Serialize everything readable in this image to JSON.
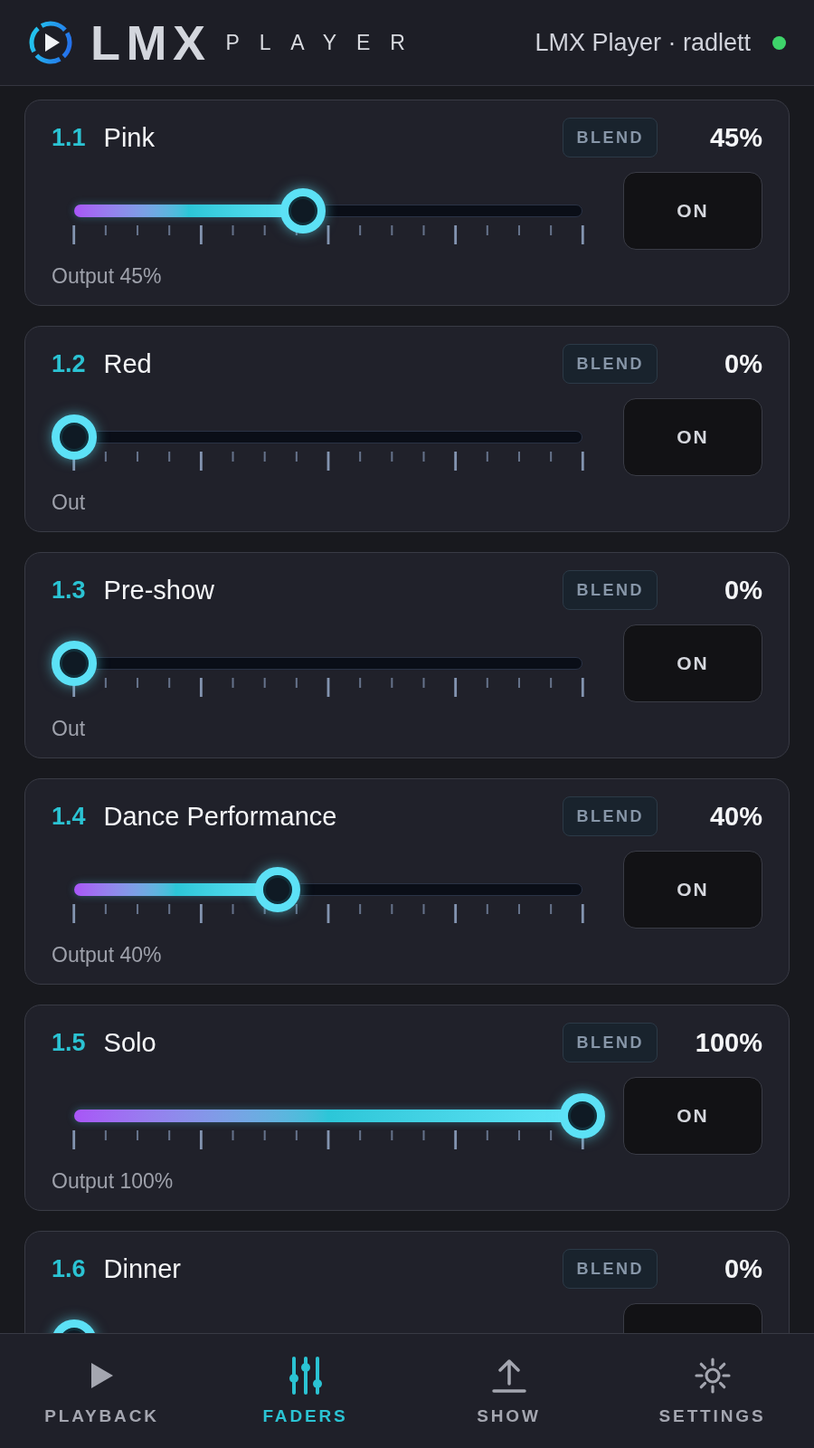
{
  "header": {
    "logo": {
      "wordmark": "LMX",
      "subtitle": "PLAYER"
    },
    "status": {
      "text": "LMX Player · radlett",
      "connected": true
    }
  },
  "faders": [
    {
      "number": "1.1",
      "name": "Pink",
      "mode": "BLEND",
      "percent": "45%",
      "level": 0.45,
      "button": "ON",
      "caption": "Output 45%"
    },
    {
      "number": "1.2",
      "name": "Red",
      "mode": "BLEND",
      "percent": "0%",
      "level": 0,
      "button": "ON",
      "caption": "Out"
    },
    {
      "number": "1.3",
      "name": "Pre-show",
      "mode": "BLEND",
      "percent": "0%",
      "level": 0,
      "button": "ON",
      "caption": "Out"
    },
    {
      "number": "1.4",
      "name": "Dance Performance",
      "mode": "BLEND",
      "percent": "40%",
      "level": 0.4,
      "button": "ON",
      "caption": "Output 40%"
    },
    {
      "number": "1.5",
      "name": "Solo",
      "mode": "BLEND",
      "percent": "100%",
      "level": 1,
      "button": "ON",
      "caption": "Output 100%"
    },
    {
      "number": "1.6",
      "name": "Dinner",
      "mode": "BLEND",
      "percent": "0%",
      "level": 0
    }
  ],
  "nav": [
    {
      "label": "PLAYBACK",
      "selected": false
    },
    {
      "label": "FADERS",
      "selected": true
    },
    {
      "label": "SHOW",
      "selected": false
    },
    {
      "label": "SETTINGS",
      "selected": false
    }
  ]
}
